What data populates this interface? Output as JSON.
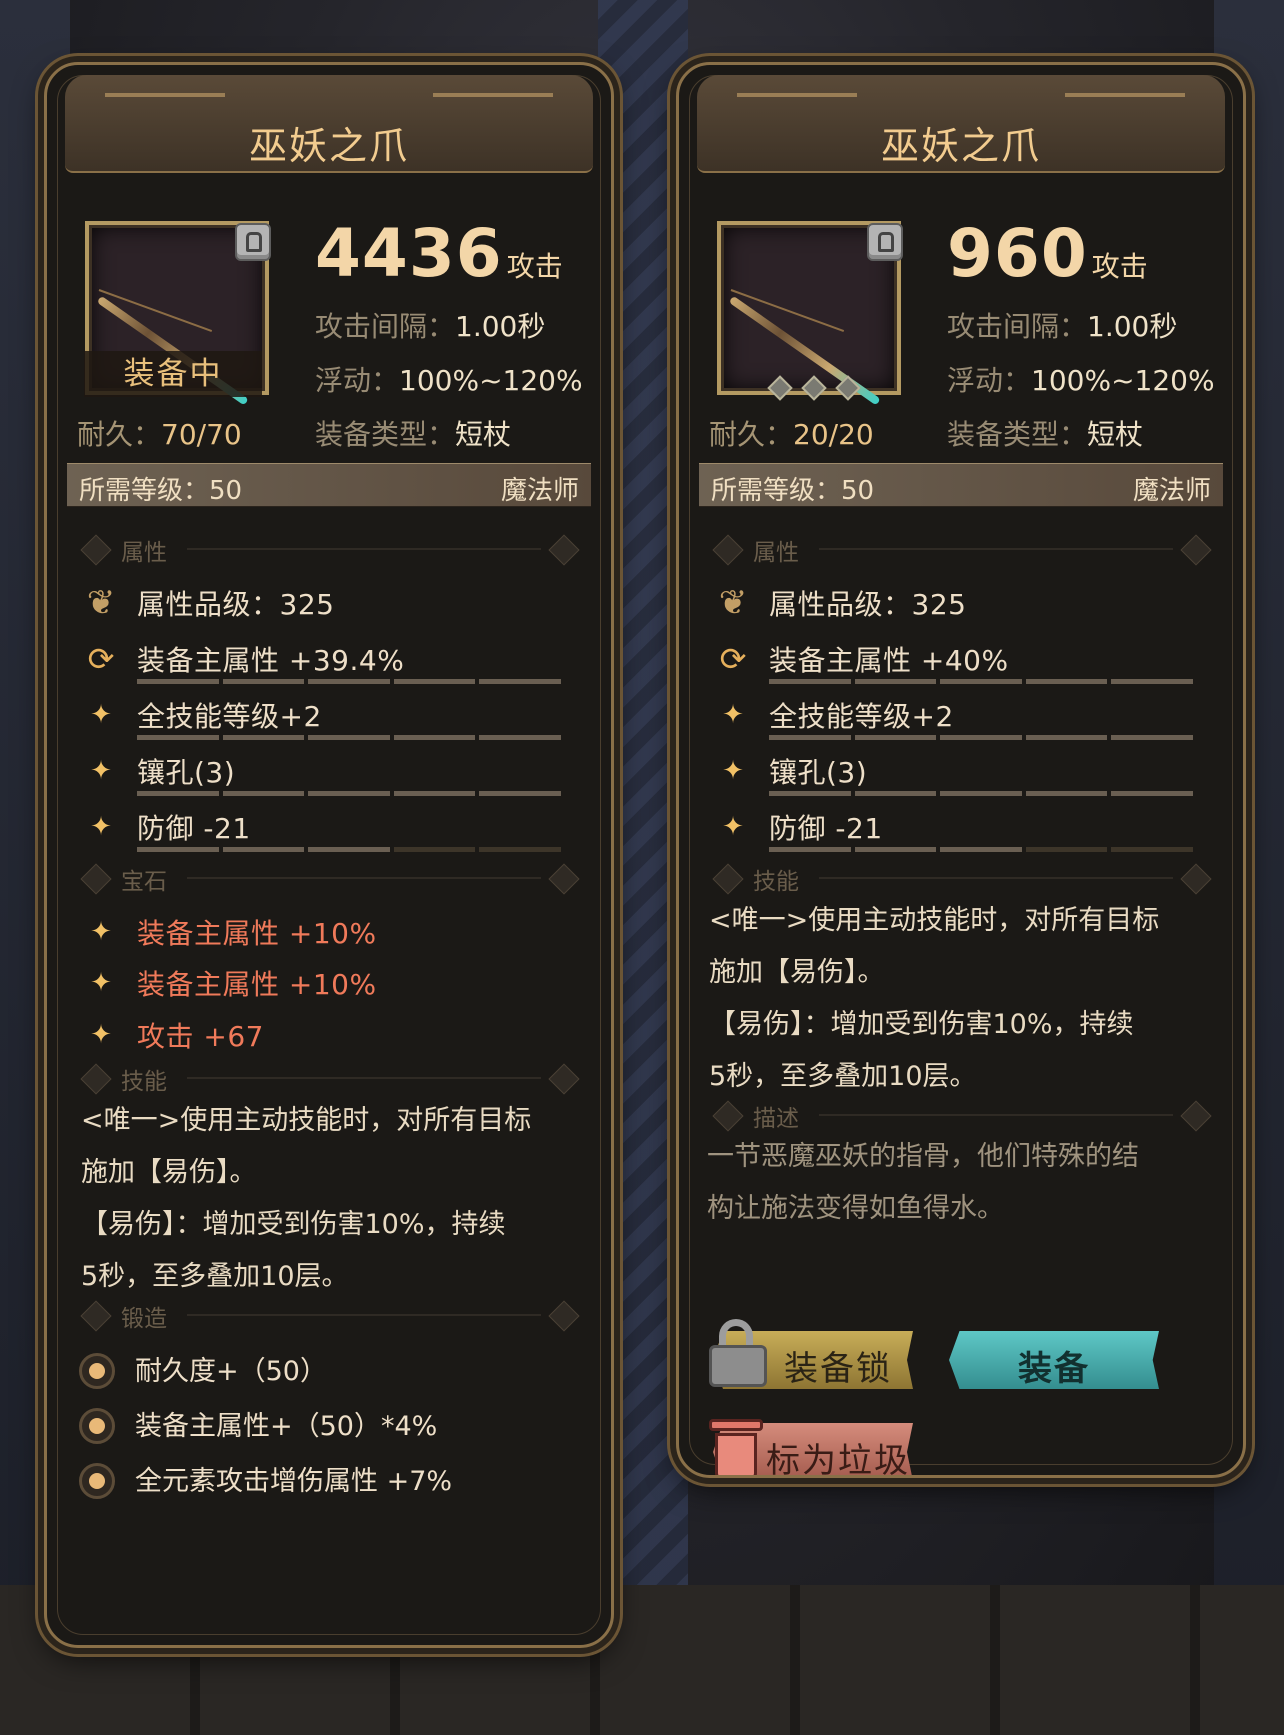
{
  "left_card": {
    "title": "巫妖之爪",
    "equipped_label": "装备中",
    "attack_value": "4436",
    "attack_unit": "攻击",
    "durability_label": "耐久：",
    "durability_value": "70/70",
    "interval_label": "攻击间隔：",
    "interval_value": "1.00秒",
    "float_label": "浮动：",
    "float_value": "100%~120%",
    "type_label": "装备类型：",
    "type_value": "短杖",
    "req_level": "所需等级：50",
    "class": "魔法师",
    "section_attr": "属性",
    "attr_rows": [
      {
        "icon": "lotus-icon",
        "text": "属性品级：325"
      },
      {
        "icon": "refresh-icon",
        "text": "装备主属性 +39.4%"
      },
      {
        "icon": "sparkle-icon",
        "text": "全技能等级+2"
      },
      {
        "icon": "sparkle-icon",
        "text": "镶孔(3)"
      },
      {
        "icon": "sparkle-icon",
        "text": "防御 -21"
      }
    ],
    "section_gem": "宝石",
    "gem_rows": [
      "装备主属性 +10%",
      "装备主属性 +10%",
      "攻击 +67"
    ],
    "section_skill": "技能",
    "skill_lines": [
      "<唯一>使用主动技能时，对所有目标",
      "施加【易伤】。",
      "【易伤】：增加受到伤害10%，持续",
      "5秒，至多叠加10层。"
    ],
    "section_forge": "锻造",
    "forge_rows": [
      "耐久度+（50）",
      "装备主属性+（50）*4%",
      "全元素攻击增伤属性 +7%"
    ]
  },
  "right_card": {
    "title": "巫妖之爪",
    "attack_value": "960",
    "attack_unit": "攻击",
    "durability_label": "耐久：",
    "durability_value": "20/20",
    "interval_label": "攻击间隔：",
    "interval_value": "1.00秒",
    "float_label": "浮动：",
    "float_value": "100%~120%",
    "type_label": "装备类型：",
    "type_value": "短杖",
    "req_level": "所需等级：50",
    "class": "魔法师",
    "section_attr": "属性",
    "attr_rows": [
      {
        "icon": "lotus-icon",
        "text": "属性品级：325"
      },
      {
        "icon": "refresh-icon",
        "text": "装备主属性 +40%"
      },
      {
        "icon": "sparkle-icon",
        "text": "全技能等级+2"
      },
      {
        "icon": "sparkle-icon",
        "text": "镶孔(3)"
      },
      {
        "icon": "sparkle-icon",
        "text": "防御 -21"
      }
    ],
    "section_skill": "技能",
    "skill_lines": [
      "<唯一>使用主动技能时，对所有目标",
      "施加【易伤】。",
      "【易伤】：增加受到伤害10%，持续",
      "5秒，至多叠加10层。"
    ],
    "section_desc": "描述",
    "desc_lines": [
      "一节恶魔巫妖的指骨，他们特殊的结",
      "构让施法变得如鱼得水。"
    ],
    "btn_lock": "装备锁",
    "btn_equip": "装备",
    "btn_trash": "标为垃圾"
  },
  "colors": {
    "gold": "#f2cc8f",
    "gem_red": "#f07a5a",
    "equip_teal": "#5ec7c6",
    "lock_yellow": "#c8ad58",
    "trash_red": "#d58c7c"
  }
}
